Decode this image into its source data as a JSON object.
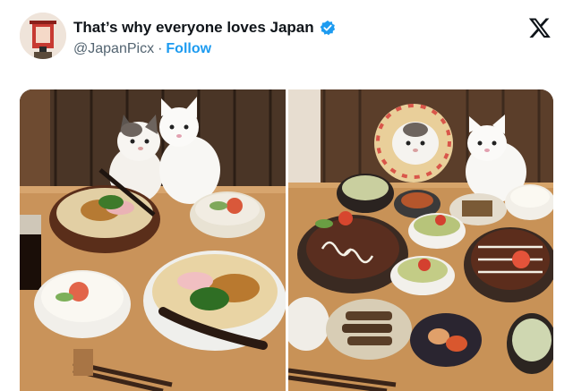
{
  "tweet": {
    "display_name": "That’s why everyone loves Japan",
    "handle": "@JapanPicx",
    "separator": "·",
    "follow_label": "Follow",
    "verified": true
  },
  "icons": {
    "verified": "verified-badge-icon",
    "platform": "x-logo-icon"
  },
  "colors": {
    "accent": "#1d9bf0",
    "text_primary": "#0f1419",
    "text_secondary": "#536471"
  },
  "media": [
    {
      "name": "cats-with-udon-meal"
    },
    {
      "name": "cats-with-okonomiyaki-meal"
    }
  ]
}
